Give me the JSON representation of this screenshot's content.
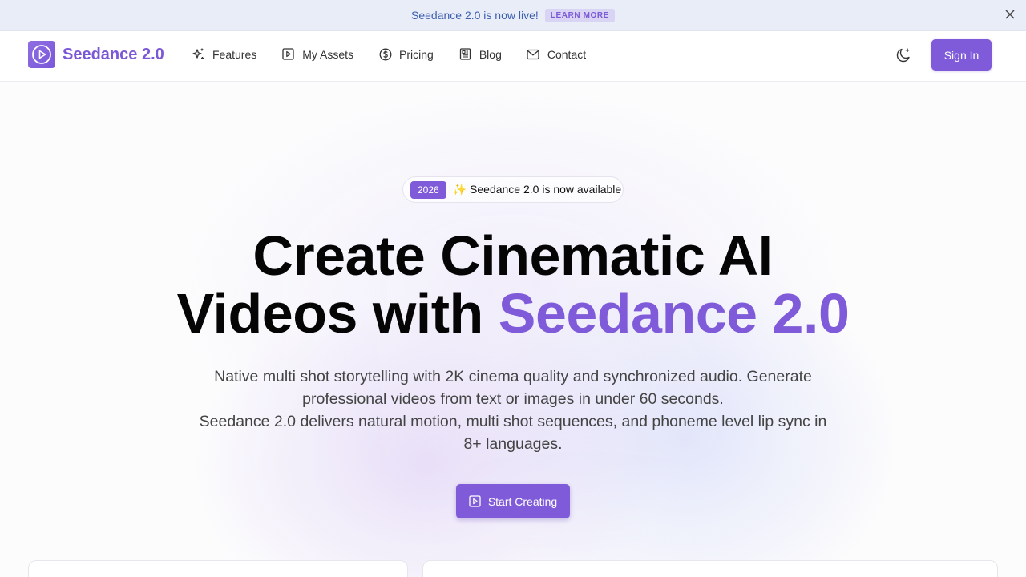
{
  "announcement": {
    "text": "Seedance 2.0 is now live!",
    "link_label": "LEARN MORE",
    "close_icon": "close-icon"
  },
  "nav": {
    "brand": "Seedance 2.0",
    "brand_icon": "play-circle-icon",
    "items": [
      {
        "label": "Features",
        "icon": "sparkles-icon"
      },
      {
        "label": "My Assets",
        "icon": "play-square-icon"
      },
      {
        "label": "Pricing",
        "icon": "dollar-circle-icon"
      },
      {
        "label": "Blog",
        "icon": "newspaper-icon"
      },
      {
        "label": "Contact",
        "icon": "mail-icon"
      }
    ],
    "theme_icon": "moon-sparkle-icon",
    "signin_label": "Sign In"
  },
  "hero": {
    "badge_year": "2026",
    "badge_emoji": "✨",
    "badge_text": "Seedance 2.0 is now available",
    "headline_line1": "Create Cinematic AI",
    "headline_line2_prefix": "Videos with ",
    "headline_accent": "Seedance 2.0",
    "subtext_line1": "Native multi shot storytelling with 2K cinema quality and synchronized audio. Generate professional videos from text or images in under 60 seconds.",
    "subtext_line2": "Seedance 2.0 delivers natural motion, multi shot sequences, and phoneme level lip sync in 8+ languages.",
    "cta_label": "Start Creating",
    "cta_icon": "play-square-icon"
  },
  "colors": {
    "accent": "#7f5bd9",
    "announcement_bg": "#e9edf8",
    "announcement_text": "#3d5fb0"
  }
}
